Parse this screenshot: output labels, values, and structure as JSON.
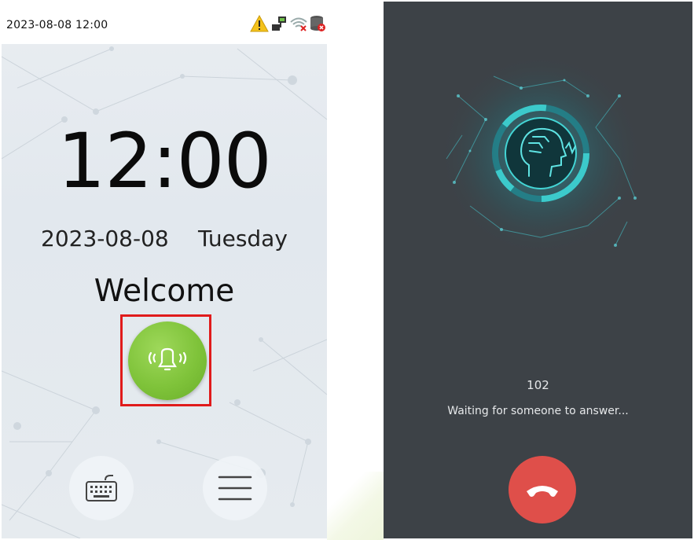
{
  "left_screen": {
    "status_bar": {
      "datetime": "2023-08-08 12:00",
      "icons": [
        "warning-icon",
        "network-icon",
        "wifi-disconnected-icon",
        "database-icon"
      ]
    },
    "clock": "12:00",
    "date": "2023-08-08",
    "weekday": "Tuesday",
    "welcome": "Welcome",
    "call_button_icon": "bell-ringing-icon",
    "keyboard_button_icon": "keyboard-icon",
    "menu_button_icon": "menu-icon",
    "colors": {
      "call_button": "#7fc33a",
      "highlight_border": "#e01b1b"
    }
  },
  "right_screen": {
    "extension": "102",
    "status_text": "Waiting for someone to answer...",
    "hangup_icon": "phone-hangup-icon",
    "logo_icon": "face-recognition-icon",
    "colors": {
      "background": "#3d4247",
      "hangup": "#df4f4a",
      "accent": "#3fd3d3"
    }
  }
}
